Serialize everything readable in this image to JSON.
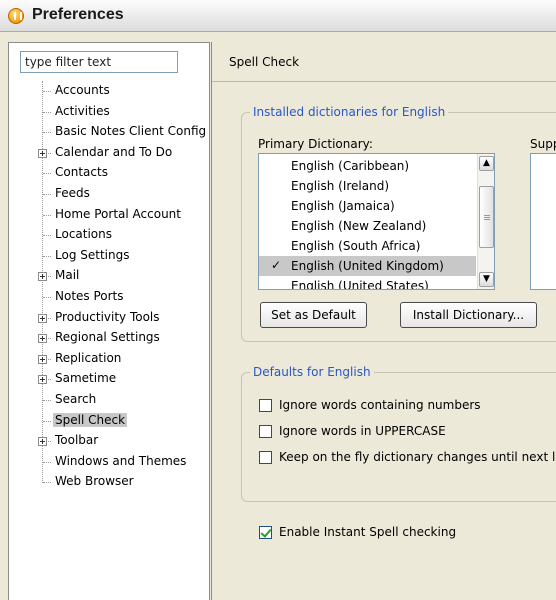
{
  "window": {
    "title": "Preferences"
  },
  "filter": {
    "value": "type filter text"
  },
  "tree": [
    {
      "label": "Accounts",
      "expandable": false
    },
    {
      "label": "Activities",
      "expandable": false
    },
    {
      "label": "Basic Notes Client Config",
      "expandable": false
    },
    {
      "label": "Calendar and To Do",
      "expandable": true
    },
    {
      "label": "Contacts",
      "expandable": false
    },
    {
      "label": "Feeds",
      "expandable": false
    },
    {
      "label": "Home Portal Account",
      "expandable": false
    },
    {
      "label": "Locations",
      "expandable": false
    },
    {
      "label": "Log Settings",
      "expandable": false
    },
    {
      "label": "Mail",
      "expandable": true
    },
    {
      "label": "Notes Ports",
      "expandable": false
    },
    {
      "label": "Productivity Tools",
      "expandable": true
    },
    {
      "label": "Regional Settings",
      "expandable": true
    },
    {
      "label": "Replication",
      "expandable": true
    },
    {
      "label": "Sametime",
      "expandable": true
    },
    {
      "label": "Search",
      "expandable": false
    },
    {
      "label": "Spell Check",
      "expandable": false,
      "selected": true
    },
    {
      "label": "Toolbar",
      "expandable": true
    },
    {
      "label": "Windows and Themes",
      "expandable": false
    },
    {
      "label": "Web Browser",
      "expandable": false
    }
  ],
  "page": {
    "title": "Spell Check",
    "installed_group": {
      "title": "Installed dictionaries for English",
      "primary_label": "Primary Dictionary:",
      "supplemental_label": "Supp",
      "dictionaries": [
        "English (Caribbean)",
        "English (Ireland)",
        "English (Jamaica)",
        "English (New Zealand)",
        "English (South Africa)",
        "English (United Kingdom)",
        "English (United States)"
      ],
      "selected_index": 5,
      "check_glyph": "✓",
      "set_default_label": "Set as Default",
      "install_label": "Install Dictionary..."
    },
    "defaults_group": {
      "title": "Defaults for English",
      "options": [
        {
          "label": "Ignore words containing numbers",
          "checked": false
        },
        {
          "label": "Ignore words in UPPERCASE",
          "checked": false
        },
        {
          "label": "Keep on the fly dictionary changes until next la",
          "checked": false
        }
      ]
    },
    "instant_spell": {
      "label": "Enable Instant Spell checking",
      "checked": true
    }
  },
  "colors": {
    "group_title": "#2857c9",
    "selection": "#c8c8c8",
    "checkmark": "#21a121"
  },
  "icons": {
    "app": "lotus-notes-icon",
    "scroll_up": "arrow-up-icon",
    "scroll_down": "arrow-down-icon"
  }
}
